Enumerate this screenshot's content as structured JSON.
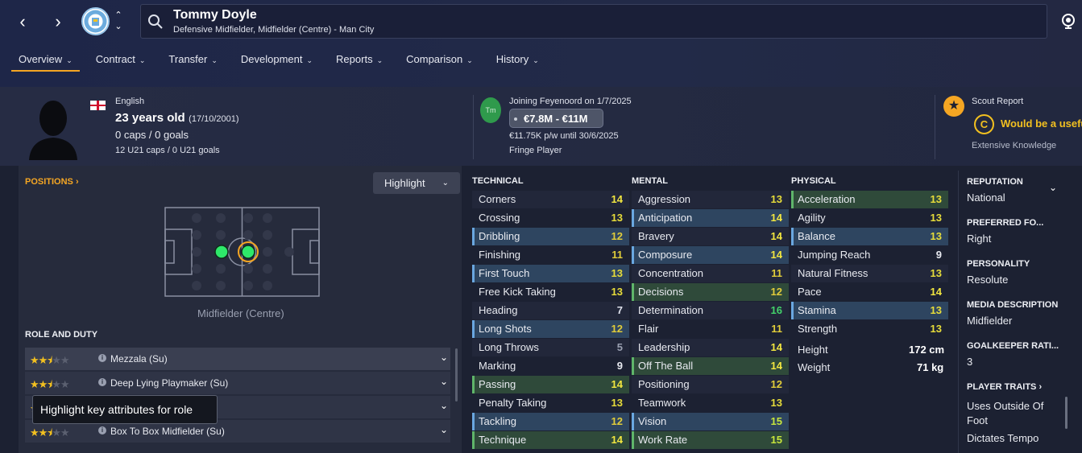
{
  "header": {
    "name": "Tommy Doyle",
    "subtitle": "Defensive Midfielder, Midfielder (Centre) - Man City",
    "crest_icon": "man-city-crest",
    "tabs": [
      "Overview",
      "Contract",
      "Transfer",
      "Development",
      "Reports",
      "Comparison",
      "History"
    ],
    "active_tab": "Overview"
  },
  "info": {
    "nationality": "English",
    "age": "23 years old",
    "dob": "(17/10/2001)",
    "caps": "0 caps / 0 goals",
    "u21": "12 U21 caps / 0 U21 goals",
    "joining": "Joining Feyenoord on 1/7/2025",
    "club_badge_text": "Tm",
    "value": "€7.8M - €11M",
    "wage": "€11.75K p/w until 30/6/2025",
    "squad_status": "Fringe Player",
    "scout_label": "Scout Report",
    "scout_verdict": "Would be a usefu",
    "scout_grade": "C",
    "knowledge": "Extensive Knowledge"
  },
  "positions": {
    "heading": "POSITIONS",
    "highlight_label": "Highlight",
    "position_label": "Midfielder (Centre)"
  },
  "roles": {
    "heading": "ROLE AND DUTY",
    "items": [
      {
        "name": "Mezzala (Su)",
        "stars": 2.5
      },
      {
        "name": "Deep Lying Playmaker (Su)",
        "stars": 2.5
      },
      {
        "name": "",
        "stars": 2.5
      },
      {
        "name": "Box To Box Midfielder (Su)",
        "stars": 2.5
      }
    ],
    "tooltip": "Highlight key attributes for role"
  },
  "technical": {
    "heading": "TECHNICAL",
    "rows": [
      {
        "n": "Corners",
        "v": "14"
      },
      {
        "n": "Crossing",
        "v": "13"
      },
      {
        "n": "Dribbling",
        "v": "12"
      },
      {
        "n": "Finishing",
        "v": "11"
      },
      {
        "n": "First Touch",
        "v": "13"
      },
      {
        "n": "Free Kick Taking",
        "v": "13"
      },
      {
        "n": "Heading",
        "v": "7"
      },
      {
        "n": "Long Shots",
        "v": "12"
      },
      {
        "n": "Long Throws",
        "v": "5"
      },
      {
        "n": "Marking",
        "v": "9"
      },
      {
        "n": "Passing",
        "v": "14"
      },
      {
        "n": "Penalty Taking",
        "v": "13"
      },
      {
        "n": "Tackling",
        "v": "12"
      },
      {
        "n": "Technique",
        "v": "14"
      }
    ]
  },
  "mental": {
    "heading": "MENTAL",
    "rows": [
      {
        "n": "Aggression",
        "v": "13"
      },
      {
        "n": "Anticipation",
        "v": "14"
      },
      {
        "n": "Bravery",
        "v": "14"
      },
      {
        "n": "Composure",
        "v": "14"
      },
      {
        "n": "Concentration",
        "v": "11"
      },
      {
        "n": "Decisions",
        "v": "12"
      },
      {
        "n": "Determination",
        "v": "16"
      },
      {
        "n": "Flair",
        "v": "11"
      },
      {
        "n": "Leadership",
        "v": "14"
      },
      {
        "n": "Off The Ball",
        "v": "14"
      },
      {
        "n": "Positioning",
        "v": "12"
      },
      {
        "n": "Teamwork",
        "v": "13"
      },
      {
        "n": "Vision",
        "v": "15"
      },
      {
        "n": "Work Rate",
        "v": "15"
      }
    ]
  },
  "physical": {
    "heading": "PHYSICAL",
    "rows": [
      {
        "n": "Acceleration",
        "v": "13"
      },
      {
        "n": "Agility",
        "v": "13"
      },
      {
        "n": "Balance",
        "v": "13"
      },
      {
        "n": "Jumping Reach",
        "v": "9"
      },
      {
        "n": "Natural Fitness",
        "v": "13"
      },
      {
        "n": "Pace",
        "v": "14"
      },
      {
        "n": "Stamina",
        "v": "13"
      },
      {
        "n": "Strength",
        "v": "13"
      }
    ],
    "height_label": "Height",
    "height": "172 cm",
    "weight_label": "Weight",
    "weight": "71 kg"
  },
  "side": {
    "reputation_label": "REPUTATION",
    "reputation": "National",
    "foot_label": "PREFERRED FO...",
    "foot": "Right",
    "personality_label": "PERSONALITY",
    "personality": "Resolute",
    "media_label": "MEDIA DESCRIPTION",
    "media": "Midfielder",
    "gk_label": "GOALKEEPER RATI...",
    "gk": "3",
    "traits_label": "PLAYER TRAITS",
    "traits": [
      "Uses Outside Of Foot",
      "Dictates Tempo"
    ]
  }
}
